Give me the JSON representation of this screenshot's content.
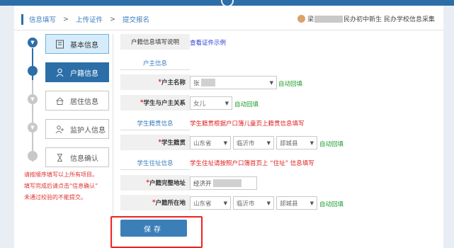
{
  "breadcrumb": [
    "信息填写",
    "上传证件",
    "提交报名"
  ],
  "school_label": {
    "prefix": "梁",
    "suffix": "民办初中新生 民办学校信息采集"
  },
  "steps": [
    {
      "label": "基本信息",
      "state": "done"
    },
    {
      "label": "户籍信息",
      "state": "current"
    },
    {
      "label": "居住信息",
      "state": "todo"
    },
    {
      "label": "监护人信息",
      "state": "todo"
    },
    {
      "label": "信息确认",
      "state": "todo"
    }
  ],
  "notes": [
    "请按顺序填写以上所有项目。",
    "填写完成后请点击“信息确认”",
    "未通过校验的不能提交。"
  ],
  "form": {
    "intro_label": "户籍信息填写说明",
    "intro_link": "查看证件示例",
    "section_huzhu": "户主信息",
    "huzhu_name_label": "户主名称",
    "huzhu_name_value": "张",
    "auto_fill": "自动回填",
    "relation_label": "学生与户主关系",
    "relation_value": "女儿",
    "section_jiguan": "学生籍贯信息",
    "jiguan_tip": "学生籍贯根据户口簿儿童页上籍贯信息填写",
    "jiguan_label": "学生籍贯",
    "jiguan_province": "山东省",
    "jiguan_city": "临沂市",
    "jiguan_county": "郯城县",
    "section_zhuzhi": "学生住址信息",
    "zhuzhi_tip": "学生住址请按照户口簿首页上 “住址” 信息填写",
    "address_label": "户籍完整地址",
    "address_value": "经济开",
    "location_label": "户籍所在地",
    "location_province": "山东省",
    "location_city": "临沂市",
    "location_county": "郯城县",
    "save_button": "保存"
  },
  "colors": {
    "primary": "#2c6ea8",
    "link": "#2a3fd0",
    "auto": "#1a9a2a",
    "required": "#e02020"
  }
}
